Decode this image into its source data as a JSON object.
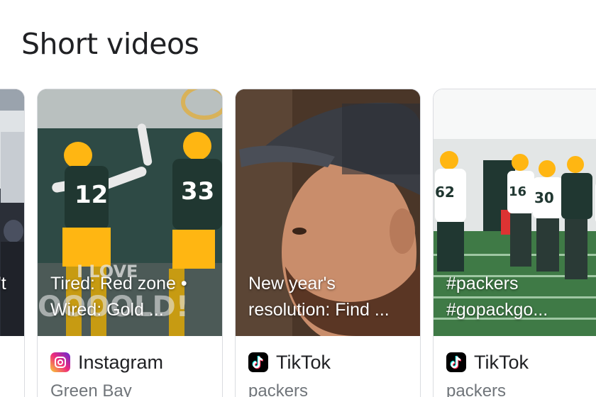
{
  "section": {
    "title": "Short videos"
  },
  "cards": [
    {
      "caption_line1": "'t",
      "caption_line2": ""
    },
    {
      "caption_line1": "Tired: Red zone •",
      "caption_line2": "Wired: Gold ...",
      "source": "Instagram",
      "source_icon": "instagram-icon",
      "subline": "Green Bay"
    },
    {
      "caption_line1": "New year's",
      "caption_line2": "resolution: Find ...",
      "source": "TikTok",
      "source_icon": "tiktok-icon",
      "subline": "packers"
    },
    {
      "caption_line1": "#packers",
      "caption_line2": "#gopackgo...",
      "source": "TikTok",
      "source_icon": "tiktok-icon",
      "subline": "packers"
    }
  ],
  "thumbnail_text": {
    "jersey_12": "12",
    "jersey_33": "33",
    "sign_text": "I LOVE",
    "sign_text_2": "OOOOLD!",
    "jersey_62": "62",
    "jersey_16": "16",
    "jersey_30": "30"
  },
  "colors": {
    "packers_green": "#203731",
    "packers_gold": "#FFB612"
  }
}
